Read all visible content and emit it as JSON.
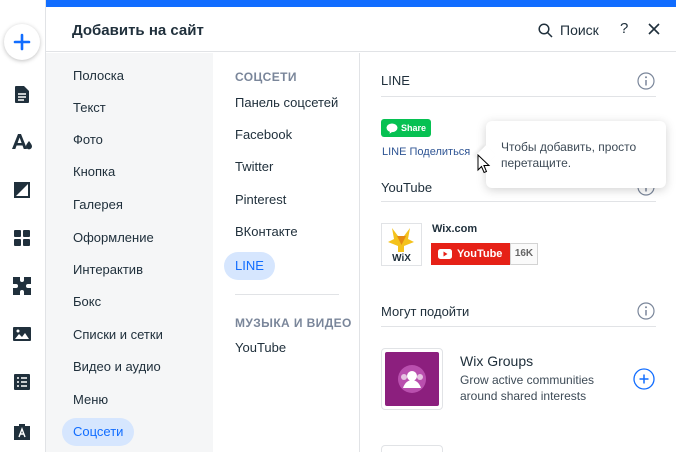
{
  "rail": {
    "add_icon": "plus-icon",
    "icons": [
      "pages-icon",
      "theme-icon",
      "background-icon",
      "apps-icon",
      "app-market-icon",
      "media-icon",
      "cms-icon",
      "portfolio-icon"
    ]
  },
  "header": {
    "title": "Добавить на сайт",
    "search_label": "Поиск",
    "help_label": "?",
    "close_icon": "close-icon"
  },
  "categories": [
    "Полоска",
    "Текст",
    "Фото",
    "Кнопка",
    "Галерея",
    "Оформление",
    "Интерактив",
    "Бокс",
    "Списки и сетки",
    "Видео и аудио",
    "Меню",
    "Соцсети"
  ],
  "active_category": "Соцсети",
  "subcategories": {
    "social_heading": "СОЦСЕТИ",
    "social_items": [
      "Панель соцсетей",
      "Facebook",
      "Twitter",
      "Pinterest",
      "ВКонтакте",
      "LINE"
    ],
    "active_item": "LINE",
    "music_heading": "МУЗЫКА И ВИДЕО",
    "music_items": [
      "YouTube"
    ]
  },
  "content": {
    "line_section": {
      "title": "LINE",
      "share_button_label": "Share",
      "caption": "LINE Поделиться"
    },
    "youtube_section": {
      "title": "YouTube",
      "channel_name": "Wix.com",
      "button_label": "YouTube",
      "subscriber_count": "16K"
    },
    "suggest_section": {
      "title": "Могут подойти",
      "app_name": "Wix Groups",
      "app_description": "Grow active communities around shared interests"
    }
  },
  "tooltip": {
    "text": "Чтобы добавить, просто перетащите."
  },
  "colors": {
    "accent": "#116dff",
    "active_bg": "#d6e6fe",
    "line_green": "#06c152",
    "youtube_red": "#e62117",
    "groups_purple": "#8c1f7e"
  }
}
